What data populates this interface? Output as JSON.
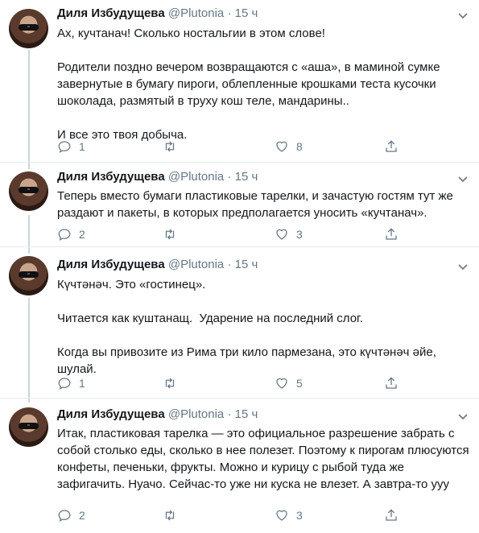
{
  "author": {
    "name": "Диля Избудущева",
    "handle": "@Plutonia",
    "dot": "·",
    "avatar": "avatar-woman-sunglasses"
  },
  "icons": {
    "reply": "reply-icon",
    "retweet": "retweet-icon",
    "like": "heart-icon",
    "share": "share-icon",
    "menu": "chevron-down-icon"
  },
  "colors": {
    "text": "#14171a",
    "muted": "#657786",
    "divider": "#e6ecf0",
    "thread": "#ccd6dd"
  },
  "tweets": [
    {
      "time": "15 ч",
      "paragraphs": [
        "Ах, кучтанач! Сколько ностальгии в этом слове!",
        "Родители поздно вечером возвращаются с «аша», в маминой сумке завернутые в бумагу пироги, облепленные крошками теста кусочки шоколада, размятый в труху кош теле, мандарины..",
        "И все это твоя добыча."
      ],
      "replies": "1",
      "retweets": "",
      "likes": "8"
    },
    {
      "time": "15 ч",
      "paragraphs": [
        "Теперь вместо бумаги пластиковые тарелки, и зачастую гостям тут же раздают и пакеты, в которых предполагается уносить «кучтанач»."
      ],
      "replies": "2",
      "retweets": "",
      "likes": "3"
    },
    {
      "time": "15 ч",
      "paragraphs": [
        "Күчтәнәч. Это «гостинец».",
        "Читается как куштанащ.  Ударение на последний слог.",
        "Когда вы привозите из Рима три кило пармезана, это күчтәнәч әйе, шулай."
      ],
      "replies": "1",
      "retweets": "",
      "likes": "5"
    },
    {
      "time": "15 ч",
      "paragraphs": [
        "Итак, пластиковая тарелка — это официальное разрешение забрать с собой столько еды, сколько в нее полезет. Поэтому к пирогам плюсуются конфеты, печеньки, фрукты. Можно и курицу с рыбой туда же зафигачить. Нуачо. Сейчас-то уже ни куска не влезет. А завтра-то ууу"
      ],
      "replies": "2",
      "retweets": "",
      "likes": "3"
    }
  ]
}
